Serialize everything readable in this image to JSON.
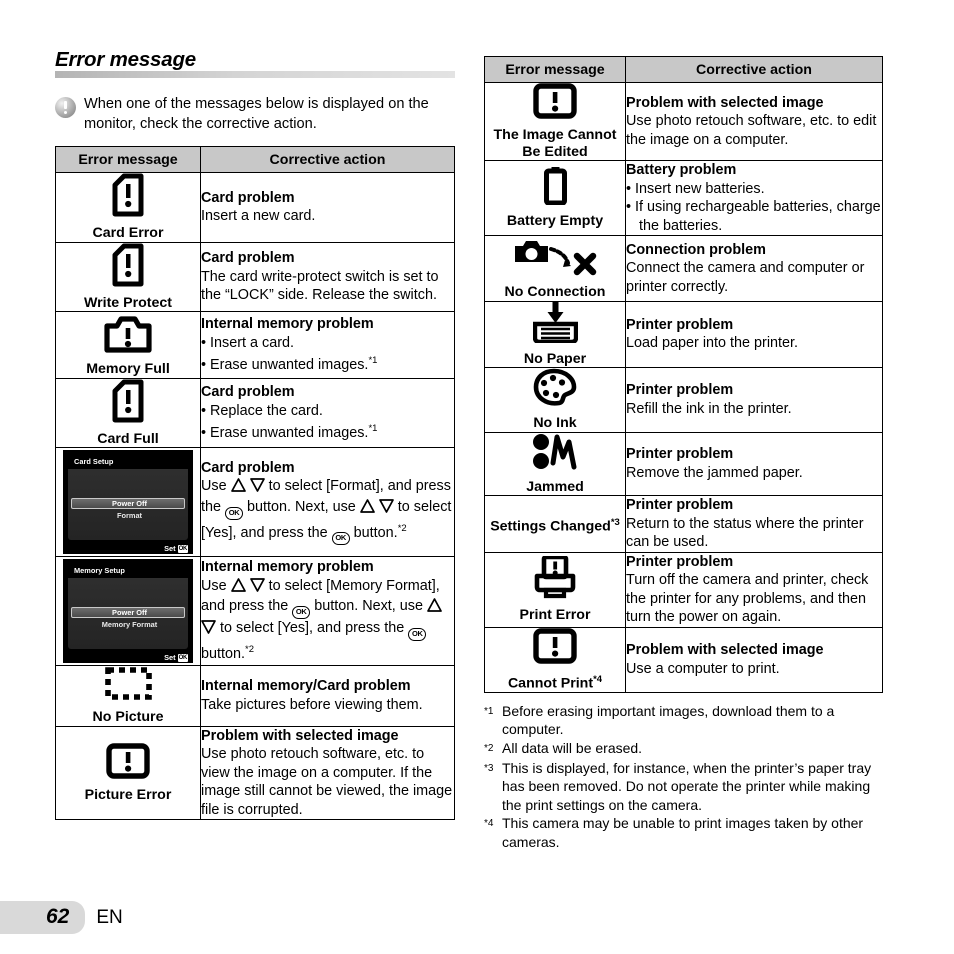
{
  "section": {
    "title": "Error message",
    "note": "When one of the messages below is displayed on the monitor, check the corrective action."
  },
  "table_headers": {
    "message": "Error message",
    "action": "Corrective action"
  },
  "left_rows": [
    {
      "icon": "card-exclamation-icon",
      "label": "Card Error",
      "action_title": "Card problem",
      "action_lines": [
        "Insert a new card."
      ]
    },
    {
      "icon": "card-exclamation-icon",
      "label": "Write Protect",
      "action_title": "Card problem",
      "action_lines": [
        "The card write-protect switch is set to the “LOCK” side. Release the switch."
      ]
    },
    {
      "icon": "camera-exclamation-icon",
      "label": "Memory Full",
      "action_title": "Internal memory problem",
      "bullets": [
        "Insert a card.",
        "Erase unwanted images."
      ],
      "bullet_footnotes": [
        "",
        "*1"
      ]
    },
    {
      "icon": "card-exclamation-icon",
      "label": "Card Full",
      "action_title": "Card problem",
      "bullets": [
        "Replace the card.",
        "Erase unwanted images."
      ],
      "bullet_footnotes": [
        "",
        "*1"
      ]
    },
    {
      "icon": "lcd-screen",
      "lcd": {
        "title": "Card Setup",
        "selected": "Power Off",
        "second": "Format",
        "set": "Set",
        "ok": "OK"
      },
      "action_title": "Card problem",
      "action_rich": "card-format-instructions",
      "footnote": "*2"
    },
    {
      "icon": "lcd-screen",
      "lcd": {
        "title": "Memory Setup",
        "selected": "Power Off",
        "second": "Memory Format",
        "set": "Set",
        "ok": "OK"
      },
      "action_title": "Internal memory problem",
      "action_rich": "memory-format-instructions",
      "footnote": "*2"
    },
    {
      "icon": "dashed-rect-icon",
      "label": "No Picture",
      "action_title": "Internal memory/Card problem",
      "action_lines": [
        "Take pictures before viewing them."
      ]
    },
    {
      "icon": "boxed-exclamation-icon",
      "label": "Picture Error",
      "action_title": "Problem with selected image",
      "action_lines": [
        "Use photo retouch software, etc. to view the image on a computer. If the image still cannot be viewed, the image file is corrupted."
      ]
    }
  ],
  "right_rows": [
    {
      "icon": "boxed-exclamation-icon",
      "label": "The Image Cannot Be Edited",
      "action_title": "Problem with selected image",
      "action_lines": [
        "Use photo retouch software, etc. to edit the image on a computer."
      ]
    },
    {
      "icon": "battery-icon",
      "label": "Battery Empty",
      "action_title": "Battery problem",
      "bullets": [
        "Insert new batteries.",
        "If using rechargeable batteries, charge the batteries."
      ]
    },
    {
      "icon": "camera-no-connection-icon",
      "label": "No Connection",
      "action_title": "Connection problem",
      "action_lines": [
        "Connect the camera and computer or printer correctly."
      ]
    },
    {
      "icon": "no-paper-icon",
      "label": "No Paper",
      "action_title": "Printer problem",
      "action_lines": [
        "Load paper into the printer."
      ]
    },
    {
      "icon": "ink-palette-icon",
      "label": "No Ink",
      "action_title": "Printer problem",
      "action_lines": [
        "Refill the ink in the printer."
      ]
    },
    {
      "icon": "paper-jam-icon",
      "label": "Jammed",
      "action_title": "Printer problem",
      "action_lines": [
        "Remove the jammed paper."
      ]
    },
    {
      "icon": "none",
      "label": "Settings Changed",
      "label_footnote": "*3",
      "action_title": "Printer problem",
      "action_lines": [
        "Return to the status where the printer can be used."
      ]
    },
    {
      "icon": "printer-error-icon",
      "label": "Print Error",
      "action_title": "Printer problem",
      "action_lines": [
        "Turn off the camera and printer, check the printer for any problems, and then turn the power on again."
      ]
    },
    {
      "icon": "boxed-exclamation-icon",
      "label": "Cannot Print",
      "label_footnote": "*4",
      "action_title": "Problem with selected image",
      "action_lines": [
        "Use a computer to print."
      ]
    }
  ],
  "instructions": {
    "card_format": {
      "p1": "Use ",
      "p2": " to select [Format], and press the ",
      "p3": " button. Next, use ",
      "p4": " to select [Yes], and press the ",
      "p5": " button.",
      "ok": "OK"
    },
    "memory_format": {
      "p1": "Use ",
      "p2": " to select [Memory Format], and press the ",
      "p3": " button. Next, use ",
      "p4": " to select [Yes], and press the ",
      "p5": " button.",
      "ok": "OK"
    }
  },
  "footnotes": [
    {
      "mark": "*1",
      "text": "Before erasing important images, download them to a computer."
    },
    {
      "mark": "*2",
      "text": "All data will be erased."
    },
    {
      "mark": "*3",
      "text": "This is displayed, for instance, when the printer’s paper tray has been removed. Do not operate the printer while making the print settings on the camera."
    },
    {
      "mark": "*4",
      "text": "This camera may be unable to print images taken by other cameras."
    }
  ],
  "footer": {
    "page_number": "62",
    "language": "EN"
  },
  "colors": {
    "header_bg": "#c8c8c8",
    "rule": "#cccccc",
    "page_tab": "#d9d9d9"
  }
}
